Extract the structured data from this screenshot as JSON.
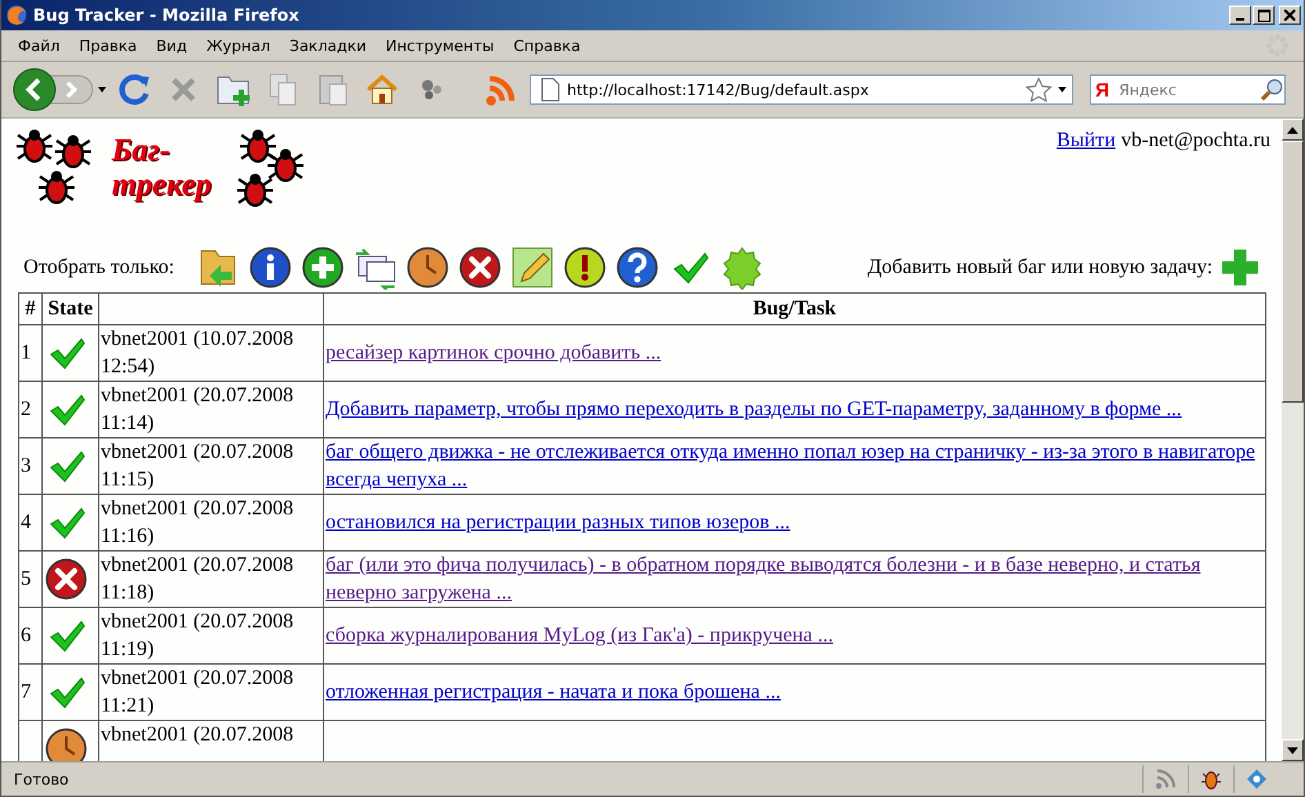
{
  "window": {
    "title": "Bug Tracker - Mozilla Firefox"
  },
  "menu": [
    "Файл",
    "Правка",
    "Вид",
    "Журнал",
    "Закладки",
    "Инструменты",
    "Справка"
  ],
  "address_bar": {
    "value": "http://localhost:17142/Bug/default.aspx"
  },
  "search": {
    "engine": "Я",
    "placeholder": "Яндекс"
  },
  "page": {
    "logo": {
      "line_1": "Баг-",
      "line_2": "трекер"
    },
    "logout_link": "Выйти",
    "user_email": "vb-net@pochta.ru",
    "filter_label": "Отобрать только:",
    "add_label": "Добавить новый баг или новую задачу:",
    "table": {
      "columns": {
        "number": "#",
        "state": "State",
        "task": "Bug/Task"
      },
      "rows": [
        {
          "number": "1",
          "kind": "done",
          "author": "vbnet2001 (10.07.2008 12:54)",
          "task": "ресайзер картинок срочно добавить ...",
          "visited": true
        },
        {
          "number": "2",
          "kind": "done",
          "author": "vbnet2001 (20.07.2008 11:14)",
          "task": "Добавить параметр, чтобы прямо переходить в разделы по GET-параметру, заданному в форме ...",
          "visited": false
        },
        {
          "number": "3",
          "kind": "done",
          "author": "vbnet2001 (20.07.2008 11:15)",
          "task": "баг общего движка - не отслеживается откуда именно попал юзер на страничку - из-за этого в навигаторе всегда чепуха ...",
          "visited": false
        },
        {
          "number": "4",
          "kind": "done",
          "author": "vbnet2001 (20.07.2008 11:16)",
          "task": "остановился на регистрации разных типов юзеров ...",
          "visited": false
        },
        {
          "number": "5",
          "kind": "rejected",
          "author": "vbnet2001 (20.07.2008 11:18)",
          "task": "баг (или это фича получилась) - в обратном порядке выводятся болезни - и в базе неверно, и статья неверно загружена ...",
          "visited": true
        },
        {
          "number": "6",
          "kind": "done",
          "author": "vbnet2001 (20.07.2008 11:19)",
          "task": "сборка журналирования MyLog (из Гак'а) - прикручена ...",
          "visited": true
        },
        {
          "number": "7",
          "kind": "done",
          "author": "vbnet2001 (20.07.2008 11:21)",
          "task": "отложенная регистрация - начата и пока брошена ...",
          "visited": false
        },
        {
          "kind": "pending",
          "author": "vbnet2001 (20.07.2008"
        }
      ]
    }
  },
  "status_bar": {
    "text": "Готово"
  }
}
